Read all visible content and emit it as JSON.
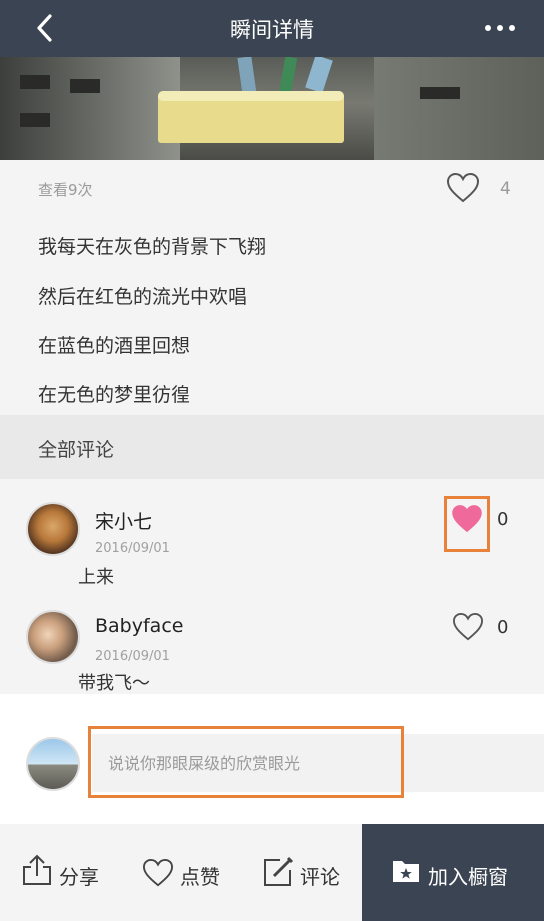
{
  "header": {
    "title": "瞬间详情",
    "back_icon": "chevron-left-icon",
    "more_icon": "more-horizontal-icon"
  },
  "post": {
    "views": "查看9次",
    "like_count": "4",
    "lines": [
      "我每天在灰色的背景下飞翔",
      "然后在红色的流光中欢唱",
      "在蓝色的酒里回想",
      "在无色的梦里彷徨"
    ]
  },
  "comments_section": {
    "title": "全部评论",
    "items": [
      {
        "name": "宋小七",
        "date": "2016/09/01",
        "text": "上来",
        "likes": "0",
        "liked": true
      },
      {
        "name": "Babyface",
        "date": "2016/09/01",
        "text": "带我飞～",
        "likes": "0",
        "liked": false
      }
    ]
  },
  "composer": {
    "placeholder": "说说你那眼屎级的欣赏眼光"
  },
  "toolbar": {
    "share": "分享",
    "like": "点赞",
    "comment": "评论",
    "add_to_window": "加入橱窗"
  },
  "colors": {
    "header_bg": "#3b4452",
    "liked_heart": "#ef6a9a",
    "highlight_box": "#e8823a"
  }
}
